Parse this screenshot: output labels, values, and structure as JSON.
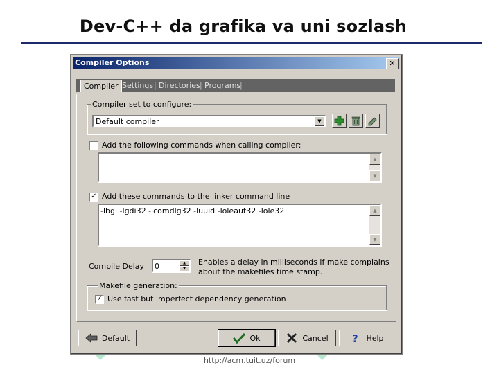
{
  "slide": {
    "title": "Dev-C++ da grafika va uni sozlash",
    "footer": "http://acm.tuit.uz/forum"
  },
  "dialog": {
    "title": "Compiler Options",
    "close_label": "✕",
    "tabs": [
      {
        "label": "Compiler",
        "active": true
      },
      {
        "label": "Settings",
        "active": false
      },
      {
        "label": "Directories",
        "active": false
      },
      {
        "label": "Programs",
        "active": false
      }
    ],
    "compiler_set": {
      "group_label": "Compiler set to configure:",
      "selected": "Default compiler"
    },
    "compiler_cmds": {
      "label": "Add the following commands when calling compiler:",
      "checked": false,
      "value": ""
    },
    "linker_cmds": {
      "label": "Add these commands to the linker command line",
      "checked": true,
      "value": "-lbgi -lgdi32 -lcomdlg32 -luuid -loleaut32 -lole32"
    },
    "compile_delay": {
      "label": "Compile Delay",
      "value": "0",
      "hint_line1": "Enables a delay in milliseconds if make complains",
      "hint_line2": "about the makefiles time stamp."
    },
    "makefile": {
      "group_label": "Makefile generation:",
      "option_label": "Use fast but imperfect dependency generation",
      "checked": true
    },
    "buttons": {
      "default_label": "Default",
      "ok_label": "Ok",
      "cancel_label": "Cancel",
      "help_label": "Help"
    }
  },
  "colors": {
    "titlebar_start": "#0a246a",
    "titlebar_end": "#a6caf0",
    "dialog_face": "#d4d0c8",
    "watermark": "#7fd4a8"
  },
  "icons": [
    "add-compiler-icon",
    "delete-compiler-icon",
    "rename-compiler-icon",
    "back-arrow-icon",
    "checkmark-icon",
    "x-cancel-icon",
    "question-help-icon"
  ]
}
